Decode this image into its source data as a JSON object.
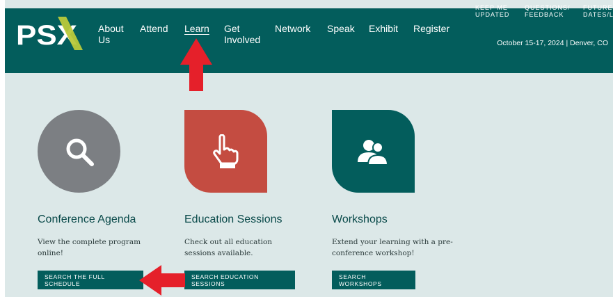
{
  "brand": {
    "logo_text": "PSX"
  },
  "nav": {
    "items": [
      {
        "label": "About Us"
      },
      {
        "label": "Attend"
      },
      {
        "label": "Learn"
      },
      {
        "label": "Get Involved"
      },
      {
        "label": "Network"
      },
      {
        "label": "Speak"
      },
      {
        "label": "Exhibit"
      },
      {
        "label": "Register"
      }
    ],
    "active": "Learn"
  },
  "utility_links": [
    {
      "label": "KEEP ME UPDATED"
    },
    {
      "label": "QUESTIONS/ FEEDBACK"
    },
    {
      "label": "FUTURE DATES/L"
    }
  ],
  "event_info": "October 15-17, 2024 | Denver, CO",
  "cards": [
    {
      "icon": "search-icon",
      "title": "Conference Agenda",
      "description": "View the complete program online!",
      "button": "SEARCH THE FULL SCHEDULE"
    },
    {
      "icon": "hand-pointer-icon",
      "title": "Education Sessions",
      "description": "Check out all education sessions available.",
      "button": "SEARCH EDUCATION SESSIONS"
    },
    {
      "icon": "users-icon",
      "title": "Workshops",
      "description": "Extend your learning with a pre-conference workshop!",
      "button": "SEARCH WORKSHOPS"
    }
  ],
  "colors": {
    "header": "#035d5c",
    "page_bg": "#dce8e8",
    "icon_gray": "#7c7f83",
    "icon_red": "#c44c41",
    "logo_accent": "#b9c93a",
    "arrow": "#e5202a"
  }
}
